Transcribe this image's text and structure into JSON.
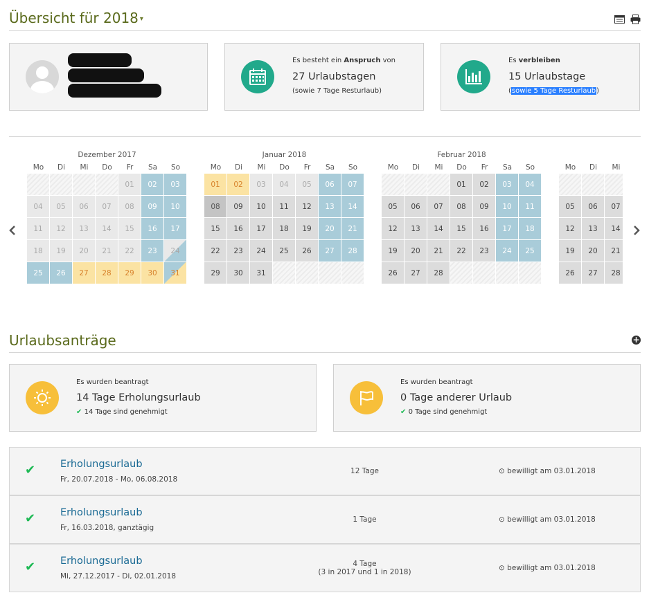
{
  "header": {
    "title": "Übersicht für 2018",
    "caret": "▾"
  },
  "profile": {
    "avatar": "avatar"
  },
  "entitlement": {
    "intro_pre": "Es besteht ein ",
    "intro_bold": "Anspruch",
    "intro_post": " von",
    "days": "27 Urlaubstagen",
    "note": "(sowie 7 Tage Resturlaub)"
  },
  "remaining": {
    "intro_pre": "Es ",
    "intro_bold": "verbleiben",
    "days": "15 Urlaubstage",
    "note_open": "(",
    "note_link": "sowie 5 Tage Resturlaub",
    "note_close": ")"
  },
  "calendar": {
    "dow": [
      "Mo",
      "Di",
      "Mi",
      "Do",
      "Fr",
      "Sa",
      "So"
    ],
    "months": [
      {
        "name": "Dezember 2017"
      },
      {
        "name": "Januar 2018"
      },
      {
        "name": "Februar 2018"
      },
      {
        "name": ""
      }
    ]
  },
  "requests_section": {
    "title": "Urlaubsanträge",
    "add_icon": "plus-circle-icon"
  },
  "summary": [
    {
      "label": "Es wurden beantragt",
      "days": "14 Tage Erholungsurlaub",
      "approved": "14 Tage sind genehmigt",
      "icon": "sun-icon"
    },
    {
      "label": "Es wurden beantragt",
      "days": "0 Tage anderer Urlaub",
      "approved": "0 Tage sind genehmigt",
      "icon": "flag-icon"
    }
  ],
  "requests": [
    {
      "type": "Erholungsurlaub",
      "range": "Fr, 20.07.2018 - Mo, 06.08.2018",
      "days": "12 Tage",
      "days_note": "",
      "status": "bewilligt am 03.01.2018"
    },
    {
      "type": "Erholungsurlaub",
      "range": "Fr, 16.03.2018, ganztägig",
      "days": "1 Tage",
      "days_note": "",
      "status": "bewilligt am 03.01.2018"
    },
    {
      "type": "Erholungsurlaub",
      "range": "Mi, 27.12.2017 - Di, 02.01.2018",
      "days": "4 Tage",
      "days_note": "(3 in 2017 und 1 in 2018)",
      "status": "bewilligt am 03.01.2018"
    }
  ],
  "colors": {
    "accent_green": "#21a98b",
    "accent_yellow": "#f7bf3a",
    "title_olive": "#5a6a1c",
    "link_blue": "#1a6a94",
    "check_green": "#1db954"
  }
}
